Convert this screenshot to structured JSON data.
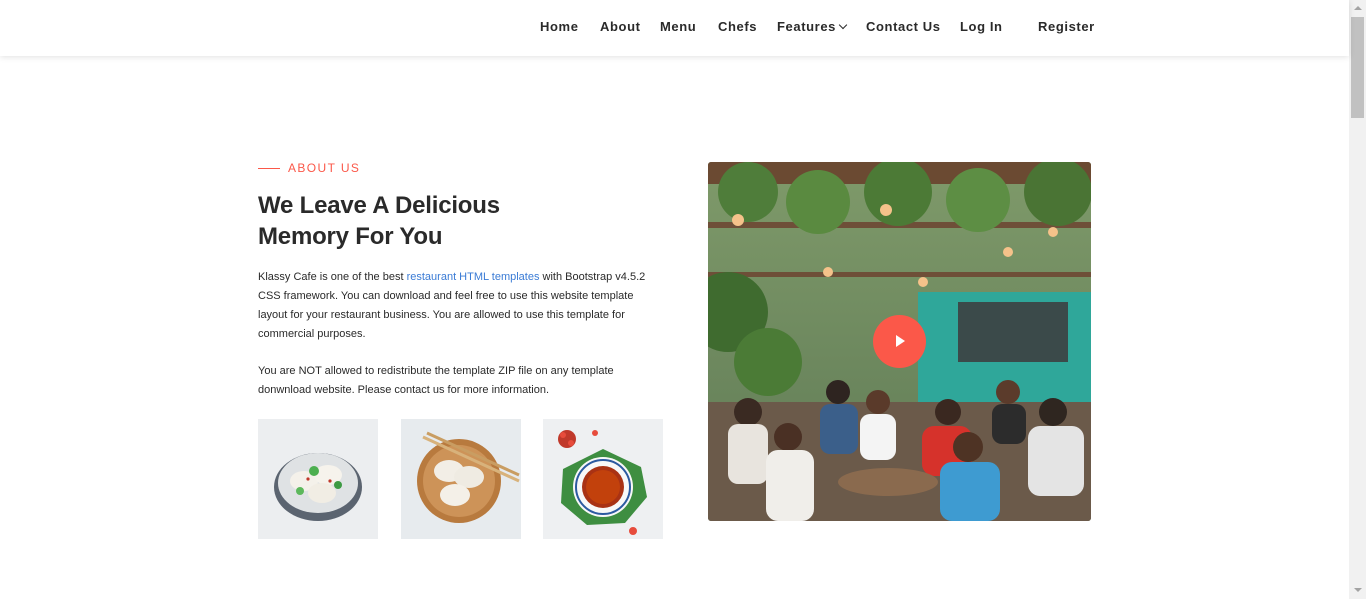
{
  "nav": {
    "items": [
      "Home",
      "About",
      "Menu",
      "Chefs",
      "Features",
      "Contact Us",
      "Log In",
      "Register"
    ]
  },
  "about": {
    "eyebrow": "ABOUT US",
    "title_line1": "We Leave A Delicious",
    "title_line2": "Memory For You",
    "p1_before": "Klassy Cafe is one of the best ",
    "p1_link": "restaurant HTML templates",
    "p1_after": " with Bootstrap v4.5.2 CSS framework. You can download and feel free to use this website template layout for your restaurant business. You are allowed to use this template for commercial purposes.",
    "p2": "You are NOT allowed to redistribute the template ZIP file on any template donwnload website. Please contact us for more information."
  },
  "colors": {
    "accent": "#fb5849",
    "link": "#3a7bd5",
    "text": "#2a2a2a"
  },
  "icons": {
    "play": "play-icon",
    "dropdown": "chevron-down-icon"
  }
}
